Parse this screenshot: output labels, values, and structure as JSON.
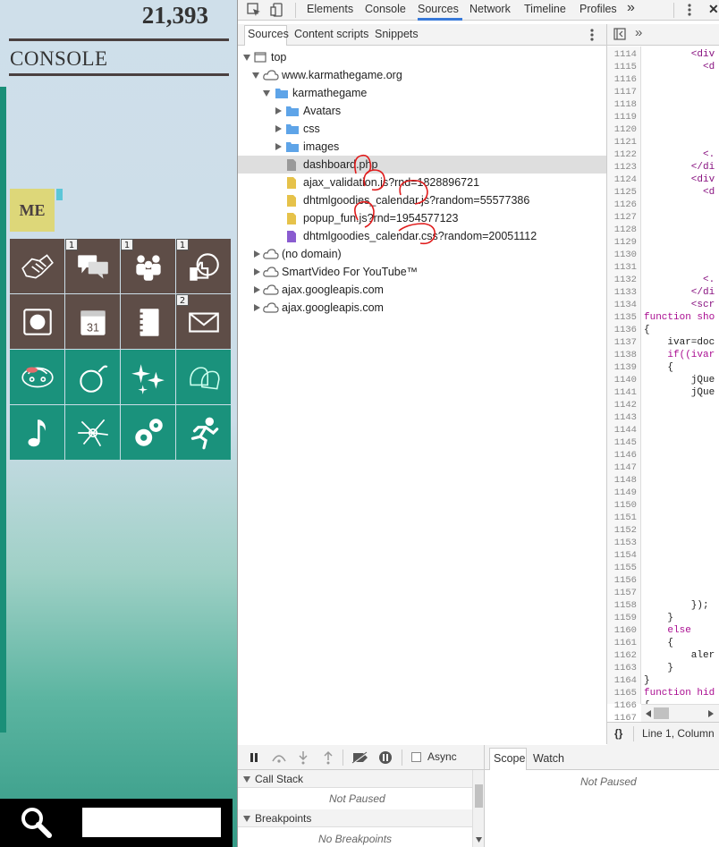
{
  "game": {
    "score": "21,393",
    "console_title": "CONSOLE",
    "me_label": "ME",
    "tiles": [
      {
        "icon": "handshake-icon",
        "badge": ""
      },
      {
        "icon": "chat-bubbles-icon",
        "badge": "1"
      },
      {
        "icon": "group-people-icon",
        "badge": "1"
      },
      {
        "icon": "thumbs-up-icon",
        "badge": "1"
      },
      {
        "icon": "safe-icon",
        "badge": ""
      },
      {
        "icon": "calendar-icon",
        "badge": ""
      },
      {
        "icon": "notebook-icon",
        "badge": ""
      },
      {
        "icon": "envelope-icon",
        "badge": "2"
      },
      {
        "icon": "turtle-icon",
        "badge": ""
      },
      {
        "icon": "bomb-icon",
        "badge": ""
      },
      {
        "icon": "sparkles-icon",
        "badge": ""
      },
      {
        "icon": "boxing-gloves-icon",
        "badge": ""
      },
      {
        "icon": "music-note-icon",
        "badge": ""
      },
      {
        "icon": "burst-icon",
        "badge": ""
      },
      {
        "icon": "gears-icon",
        "badge": ""
      },
      {
        "icon": "running-man-icon",
        "badge": ""
      }
    ],
    "calendar_day": "31"
  },
  "devtools": {
    "top_tabs": [
      "Elements",
      "Console",
      "Sources",
      "Network",
      "Timeline",
      "Profiles"
    ],
    "more_tabs": "»",
    "close": "✕",
    "sub_tabs": [
      "Sources",
      "Content scripts",
      "Snippets"
    ],
    "tree": {
      "top": "top",
      "domain": "www.karmathegame.org",
      "folder": "karmathegame",
      "subfolders": [
        "Avatars",
        "css",
        "images"
      ],
      "files": [
        "dashboard.php",
        "ajax_validation.js?rnd=1828896721",
        "dhtmlgoodies_calendar.js?random=55577386",
        "popup_fun.js?rnd=1954577123",
        "dhtmlgoodies_calendar.css?random=20051112"
      ],
      "other": [
        "(no domain)",
        "SmartVideo For YouTube™",
        "ajax.googleapis.com",
        "ajax.googleapis.com"
      ]
    },
    "line_numbers": [
      "1114",
      "1115",
      "1116",
      "1117",
      "1118",
      "1119",
      "1120",
      "1121",
      "1122",
      "1123",
      "1124",
      "1125",
      "1126",
      "1127",
      "1128",
      "1129",
      "1130",
      "1131",
      "1132",
      "1133",
      "1134",
      "1135",
      "1136",
      "1137",
      "1138",
      "1139",
      "1140",
      "1141",
      "1142",
      "1143",
      "1144",
      "1145",
      "1146",
      "1147",
      "1148",
      "1149",
      "1150",
      "1151",
      "1152",
      "1153",
      "1154",
      "1155",
      "1156",
      "1157",
      "1158",
      "1159",
      "1160",
      "1161",
      "1162",
      "1163",
      "1164",
      "1165",
      "1166",
      "1167"
    ],
    "code_lines": [
      {
        "n": 0,
        "text": "        <div",
        "cls": "tg"
      },
      {
        "n": 1,
        "text": "          <d",
        "cls": "tg"
      },
      {
        "n": 8,
        "text": "          <.",
        "cls": "tg"
      },
      {
        "n": 9,
        "text": "        </di",
        "cls": "tg"
      },
      {
        "n": 10,
        "text": "        <div",
        "cls": "tg"
      },
      {
        "n": 11,
        "text": "          <d",
        "cls": "tg"
      },
      {
        "n": 18,
        "text": "          <.",
        "cls": "tg"
      },
      {
        "n": 19,
        "text": "        </di",
        "cls": "tg"
      },
      {
        "n": 20,
        "text": "        <scr",
        "cls": "tg"
      },
      {
        "n": 21,
        "text": "function sho",
        "cls": "kw"
      },
      {
        "n": 22,
        "text": "{",
        "cls": ""
      },
      {
        "n": 23,
        "text": "    ivar=doc",
        "cls": ""
      },
      {
        "n": 24,
        "text": "    if((ivar",
        "cls": "kw"
      },
      {
        "n": 25,
        "text": "    {",
        "cls": ""
      },
      {
        "n": 26,
        "text": "        jQue",
        "cls": ""
      },
      {
        "n": 27,
        "text": "        jQue",
        "cls": ""
      },
      {
        "n": 44,
        "text": "        });",
        "cls": ""
      },
      {
        "n": 45,
        "text": "    }",
        "cls": ""
      },
      {
        "n": 46,
        "text": "    else",
        "cls": "kw"
      },
      {
        "n": 47,
        "text": "    {",
        "cls": ""
      },
      {
        "n": 48,
        "text": "        aler",
        "cls": ""
      },
      {
        "n": 49,
        "text": "    }",
        "cls": ""
      },
      {
        "n": 50,
        "text": "}",
        "cls": ""
      },
      {
        "n": 51,
        "text": "function hid",
        "cls": "kw"
      },
      {
        "n": 52,
        "text": "{",
        "cls": ""
      }
    ],
    "status": "Line 1, Column",
    "braces": "{}",
    "debugger": {
      "async_label": "Async",
      "call_stack": "Call Stack",
      "call_stack_state": "Not Paused",
      "breakpoints": "Breakpoints",
      "breakpoints_state": "No Breakpoints",
      "scope_tab": "Scope",
      "watch_tab": "Watch",
      "scope_state": "Not Paused"
    }
  }
}
